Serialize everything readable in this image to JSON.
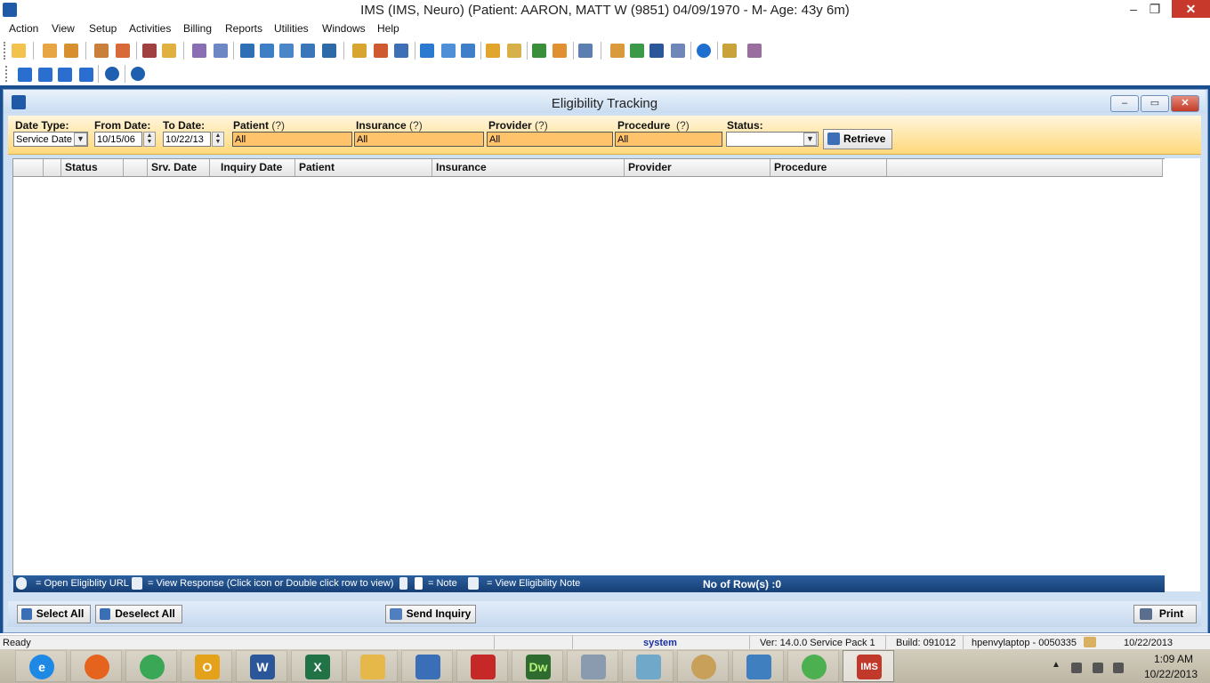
{
  "window": {
    "title": "IMS (IMS, Neuro)     (Patient: AARON, MATT W (9851) 04/09/1970 - M- Age: 43y 6m)",
    "minimize": "–",
    "restore": "❐",
    "close": "✕"
  },
  "menu": [
    "Action",
    "View",
    "Setup",
    "Activities",
    "Billing",
    "Reports",
    "Utilities",
    "Windows",
    "Help"
  ],
  "child_window": {
    "title": "Eligibility Tracking"
  },
  "filters": {
    "date_type_label": "Date Type:",
    "date_type_value": "Service Date",
    "from_date_label": "From Date:",
    "from_date_value": "10/15/06",
    "to_date_label": "To Date:",
    "to_date_value": "10/22/13",
    "patient_label": "Patient",
    "patient_value": "All",
    "insurance_label": "Insurance",
    "insurance_value": "All",
    "provider_label": "Provider",
    "provider_value": "All",
    "procedure_label": "Procedure",
    "procedure_value": "All",
    "status_label": "Status:",
    "status_value": "",
    "help_mark": "(?)",
    "retrieve_label": "Retrieve"
  },
  "grid": {
    "columns": [
      "",
      "",
      "Status",
      "",
      "Srv. Date",
      "Inquiry Date",
      "Patient",
      "Insurance",
      "Provider",
      "Procedure",
      ""
    ]
  },
  "legend": {
    "open_url": "= Open Eligiblity URL",
    "view_response": "= View Response (Click icon or Double click row to view)",
    "note": "= Note",
    "view_note": "= View Eligibility Note",
    "row_count": "No of Row(s) :0"
  },
  "buttons": {
    "select_all": "Select All",
    "deselect_all": "Deselect All",
    "send_inquiry": "Send Inquiry",
    "print": "Print"
  },
  "status_bar": {
    "state": "Ready",
    "user": "system",
    "version": "Ver: 14.0.0 Service Pack 1",
    "build": "Build: 091012",
    "machine": "hpenvylaptop - 0050335",
    "date": "10/22/2013"
  },
  "taskbar": {
    "apps": [
      {
        "name": "internet-explorer",
        "glyph": "e",
        "color": "#1e88e5"
      },
      {
        "name": "firefox",
        "glyph": "",
        "color": "#e6631e"
      },
      {
        "name": "chrome",
        "glyph": "",
        "color": "#3aa757"
      },
      {
        "name": "outlook",
        "glyph": "O",
        "color": "#e3a21a"
      },
      {
        "name": "word",
        "glyph": "W",
        "color": "#2b579a"
      },
      {
        "name": "excel",
        "glyph": "X",
        "color": "#217346"
      },
      {
        "name": "file-explorer",
        "glyph": "",
        "color": "#e6b84a"
      },
      {
        "name": "remote-desktop",
        "glyph": "",
        "color": "#3a6fb7"
      },
      {
        "name": "acrobat",
        "glyph": "",
        "color": "#c62828"
      },
      {
        "name": "dreamweaver",
        "glyph": "Dw",
        "color": "#2e6b2e"
      },
      {
        "name": "calculator",
        "glyph": "",
        "color": "#8a9bb0"
      },
      {
        "name": "notes",
        "glyph": "",
        "color": "#6fa8c8"
      },
      {
        "name": "paint",
        "glyph": "",
        "color": "#c8a05a"
      },
      {
        "name": "control-panel",
        "glyph": "",
        "color": "#3f7fc0"
      },
      {
        "name": "dragon",
        "glyph": "",
        "color": "#4caf50"
      },
      {
        "name": "ims",
        "glyph": "IMS",
        "color": "#c0392b"
      }
    ],
    "time": "1:09 AM",
    "date": "10/22/2013"
  }
}
